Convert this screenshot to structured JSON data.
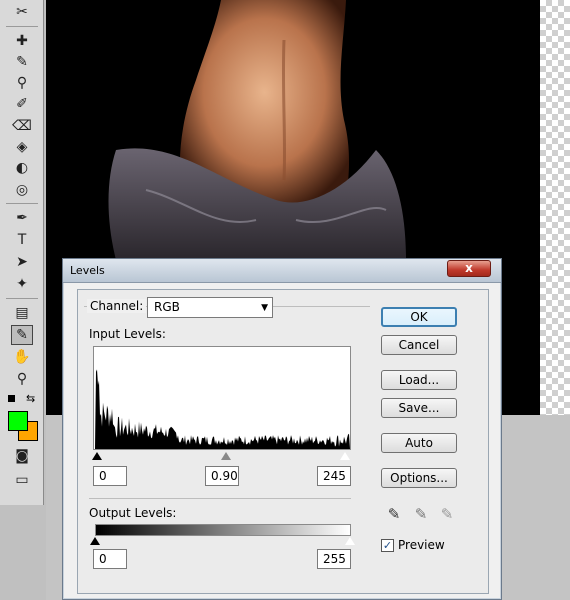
{
  "toolbox": {
    "tools": [
      {
        "name": "slice-tool-icon",
        "glyph": "✂"
      },
      {
        "name": "healing-brush-icon",
        "glyph": "✚"
      },
      {
        "name": "brush-tool-icon",
        "glyph": "✎"
      },
      {
        "name": "clone-stamp-icon",
        "glyph": "⚲"
      },
      {
        "name": "history-brush-icon",
        "glyph": "✐"
      },
      {
        "name": "eraser-tool-icon",
        "glyph": "⌫"
      },
      {
        "name": "paint-bucket-icon",
        "glyph": "◈"
      },
      {
        "name": "blur-tool-icon",
        "glyph": "◐"
      },
      {
        "name": "dodge-tool-icon",
        "glyph": "◎"
      },
      {
        "name": "pen-tool-icon",
        "glyph": "✒"
      },
      {
        "name": "type-tool-icon",
        "glyph": "T"
      },
      {
        "name": "path-selection-icon",
        "glyph": "➤"
      },
      {
        "name": "custom-shape-icon",
        "glyph": "✦"
      },
      {
        "name": "notes-tool-icon",
        "glyph": "▤"
      },
      {
        "name": "eyedropper-tool-icon",
        "glyph": "✎"
      },
      {
        "name": "hand-tool-icon",
        "glyph": "✋"
      },
      {
        "name": "zoom-tool-icon",
        "glyph": "⚲"
      }
    ],
    "foreground_color": "#00ff00",
    "background_color": "#ffa500"
  },
  "dialog": {
    "title": "Levels",
    "close_label": "x",
    "channel_label": "Channel:",
    "channel_value": "RGB",
    "input_levels_label": "Input Levels:",
    "input_black": "0",
    "input_gamma": "0.90",
    "input_white": "245",
    "output_levels_label": "Output Levels:",
    "output_black": "0",
    "output_white": "255",
    "buttons": {
      "ok": "OK",
      "cancel": "Cancel",
      "load": "Load...",
      "save": "Save...",
      "auto": "Auto",
      "options": "Options..."
    },
    "preview_label": "Preview",
    "preview_checked": true
  }
}
